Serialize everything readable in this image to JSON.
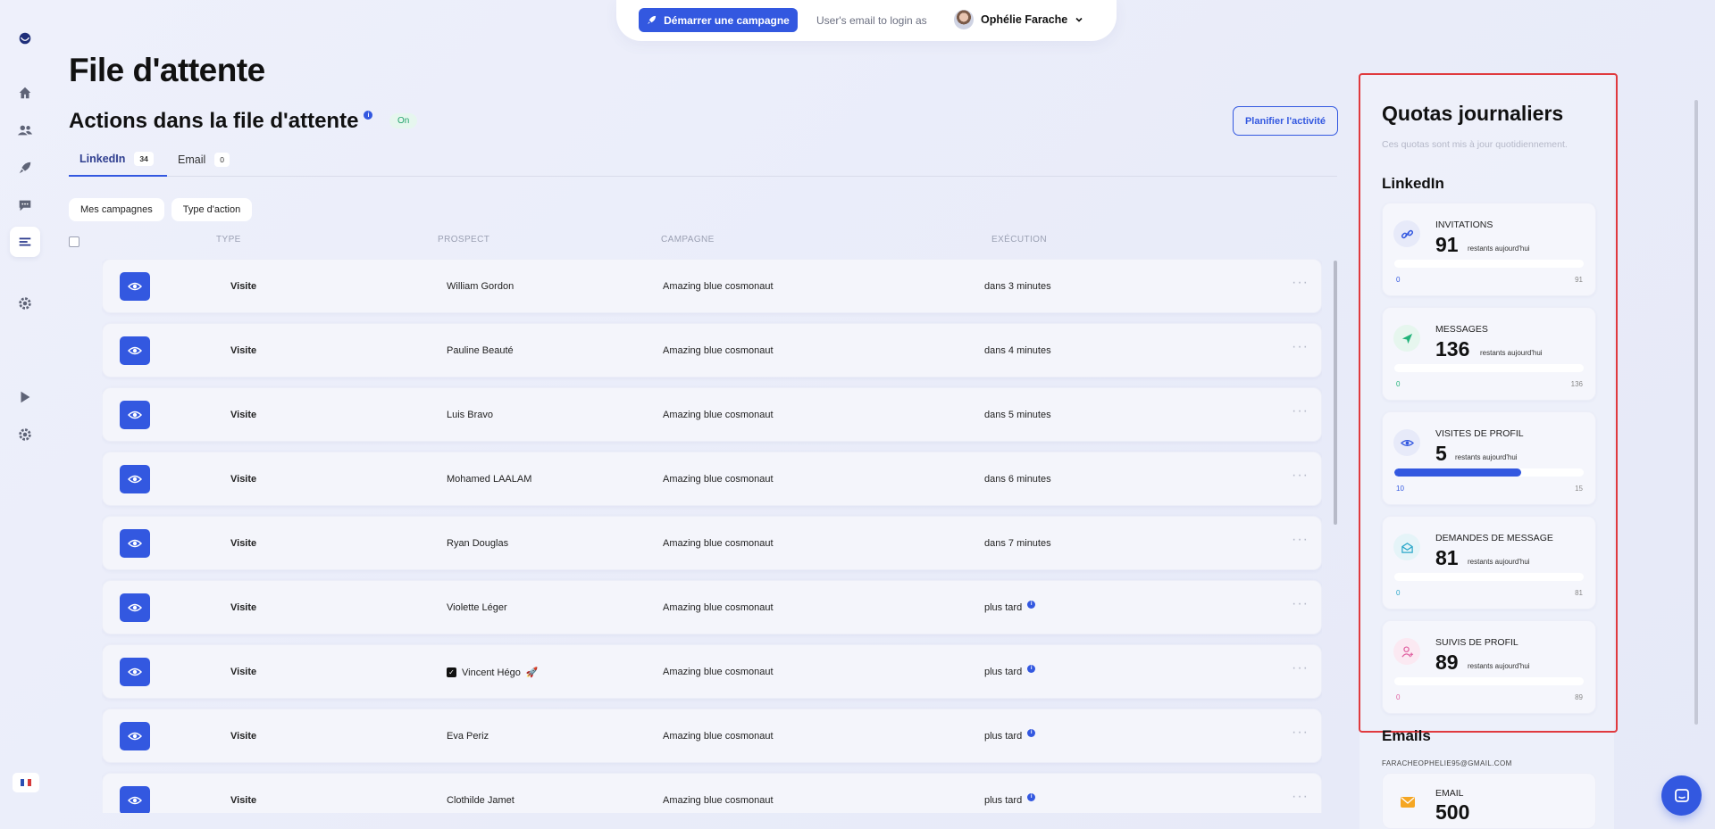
{
  "topbar": {
    "start_campaign": "Démarrer une campagne",
    "login_label": "User's email to login as",
    "user_name": "Ophélie Farache"
  },
  "page": {
    "title": "File d'attente",
    "section_title": "Actions dans la file d'attente",
    "status_badge": "On",
    "plan_button": "Planifier l'activité"
  },
  "tabs": [
    {
      "label": "LinkedIn",
      "count": "34",
      "active": true
    },
    {
      "label": "Email",
      "count": "0",
      "active": false
    }
  ],
  "filters": [
    "Mes campagnes",
    "Type d'action"
  ],
  "table": {
    "headers": [
      "TYPE",
      "PROSPECT",
      "CAMPAGNE",
      "EXÉCUTION"
    ],
    "rows": [
      {
        "type": "Visite",
        "prospect": "William Gordon",
        "campaign": "Amazing blue cosmonaut",
        "execution": "dans 3 minutes",
        "info": false
      },
      {
        "type": "Visite",
        "prospect": "Pauline Beauté",
        "campaign": "Amazing blue cosmonaut",
        "execution": "dans 4 minutes",
        "info": false
      },
      {
        "type": "Visite",
        "prospect": "Luis Bravo",
        "campaign": "Amazing blue cosmonaut",
        "execution": "dans 5 minutes",
        "info": false
      },
      {
        "type": "Visite",
        "prospect": "Mohamed LAALAM",
        "campaign": "Amazing blue cosmonaut",
        "execution": "dans 6 minutes",
        "info": false
      },
      {
        "type": "Visite",
        "prospect": "Ryan Douglas",
        "campaign": "Amazing blue cosmonaut",
        "execution": "dans 7 minutes",
        "info": false
      },
      {
        "type": "Visite",
        "prospect": "Violette Léger",
        "campaign": "Amazing blue cosmonaut",
        "execution": "plus tard",
        "info": true
      },
      {
        "type": "Visite",
        "prospect": "Vincent Hégo",
        "campaign": "Amazing blue cosmonaut",
        "execution": "plus tard",
        "info": true,
        "decorated": true
      },
      {
        "type": "Visite",
        "prospect": "Eva Periz",
        "campaign": "Amazing blue cosmonaut",
        "execution": "plus tard",
        "info": true
      },
      {
        "type": "Visite",
        "prospect": "Clothilde Jamet",
        "campaign": "Amazing blue cosmonaut",
        "execution": "plus tard",
        "info": true
      }
    ]
  },
  "quotas": {
    "title": "Quotas journaliers",
    "subtitle": "Ces quotas sont mis à jour quotidiennement.",
    "linkedin_heading": "LinkedIn",
    "remaining_label": "restants aujourd'hui",
    "cards": [
      {
        "label": "INVITATIONS",
        "value": "91",
        "min": "0",
        "max": "91",
        "used_fraction": 0.0,
        "icon": "link-icon",
        "icon_color": "#3358e0",
        "icon_bg": "#e7eaf9"
      },
      {
        "label": "MESSAGES",
        "value": "136",
        "min": "0",
        "max": "136",
        "used_fraction": 0.0,
        "icon": "send-icon",
        "icon_color": "#22b37a",
        "icon_bg": "#e6f6ee"
      },
      {
        "label": "VISITES DE PROFIL",
        "value": "5",
        "min": "10",
        "max": "15",
        "used_fraction": 0.67,
        "icon": "eye-icon",
        "icon_color": "#3358e0",
        "icon_bg": "#e7eaf9"
      },
      {
        "label": "DEMANDES DE MESSAGE",
        "value": "81",
        "min": "0",
        "max": "81",
        "used_fraction": 0.0,
        "icon": "mail-open-icon",
        "icon_color": "#2aa7c9",
        "icon_bg": "#e5f4f8"
      },
      {
        "label": "SUIVIS DE PROFIL",
        "value": "89",
        "min": "0",
        "max": "89",
        "used_fraction": 0.0,
        "icon": "user-follow-icon",
        "icon_color": "#e05fa0",
        "icon_bg": "#fbe9f2"
      }
    ],
    "emails_heading": "Emails",
    "email_address": "FARACHEOPHELIE95@GMAIL.COM",
    "email_card": {
      "label": "EMAIL",
      "value": "500"
    }
  },
  "colors": {
    "accent": "#3358e0",
    "status_on": "#22a36b",
    "highlight": "#e03a3e"
  }
}
